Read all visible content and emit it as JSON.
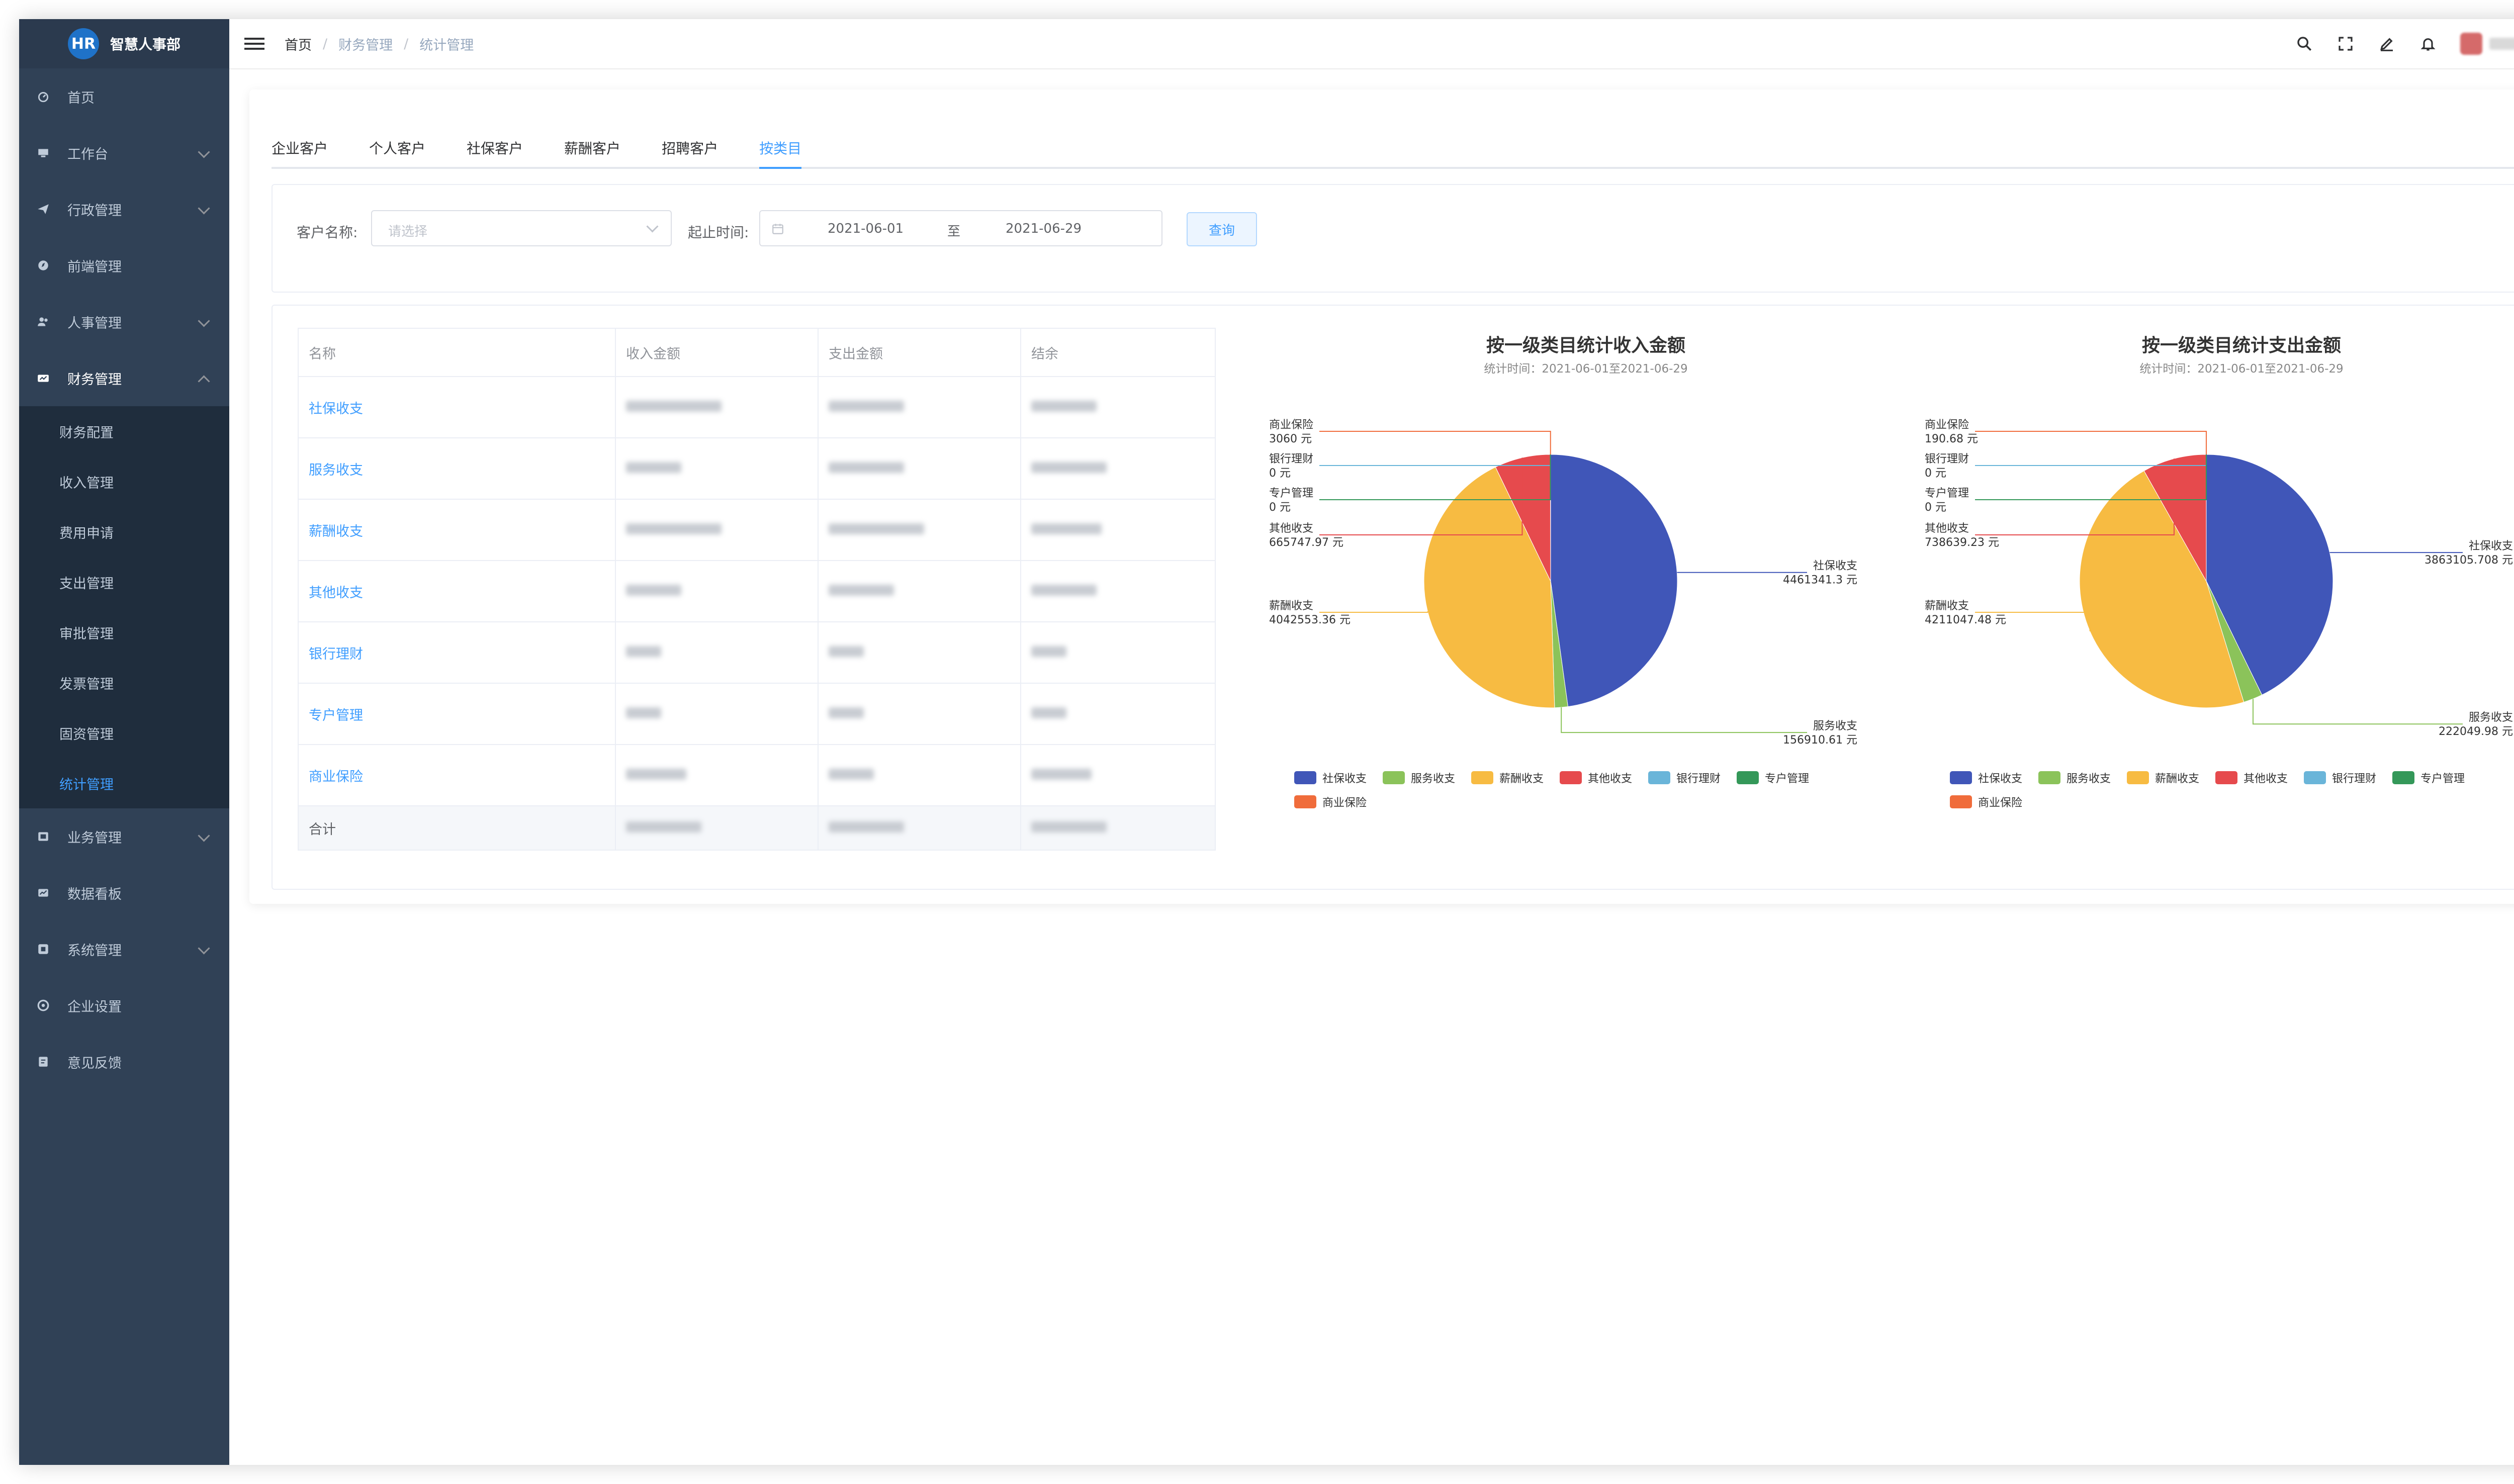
{
  "app": {
    "logo_text": "HR",
    "title": "智慧人事部"
  },
  "sidebar": {
    "items": [
      {
        "label": "首页",
        "icon": "dashboard-icon",
        "has_children": false
      },
      {
        "label": "工作台",
        "icon": "desk-icon",
        "has_children": true
      },
      {
        "label": "行政管理",
        "icon": "send-icon",
        "has_children": true
      },
      {
        "label": "前端管理",
        "icon": "compass-icon",
        "has_children": false
      },
      {
        "label": "人事管理",
        "icon": "people-icon",
        "has_children": true
      },
      {
        "label": "财务管理",
        "icon": "money-icon",
        "has_children": true,
        "open": true,
        "children": [
          "财务配置",
          "收入管理",
          "费用申请",
          "支出管理",
          "审批管理",
          "发票管理",
          "固资管理",
          "统计管理"
        ],
        "active_child": 7
      },
      {
        "label": "业务管理",
        "icon": "briefcase-icon",
        "has_children": true
      },
      {
        "label": "数据看板",
        "icon": "chart-icon",
        "has_children": false
      },
      {
        "label": "系统管理",
        "icon": "system-icon",
        "has_children": true
      },
      {
        "label": "企业设置",
        "icon": "settings-icon",
        "has_children": false
      },
      {
        "label": "意见反馈",
        "icon": "feedback-icon",
        "has_children": false
      }
    ]
  },
  "navbar": {
    "breadcrumb": [
      "首页",
      "财务管理",
      "统计管理"
    ],
    "icons": [
      "search-icon",
      "fullscreen-icon",
      "edit-icon",
      "bell-icon"
    ]
  },
  "tabs": [
    "企业客户",
    "个人客户",
    "社保客户",
    "薪酬客户",
    "招聘客户",
    "按类目"
  ],
  "active_tab": 5,
  "filter": {
    "customer_label": "客户名称:",
    "customer_placeholder": "请选择",
    "date_label": "起止时间:",
    "start_date": "2021-06-01",
    "range_sep": "至",
    "end_date": "2021-06-29",
    "query_button": "查询"
  },
  "table": {
    "headers": [
      "名称",
      "收入金额",
      "支出金额",
      "结余"
    ],
    "rows": [
      {
        "name": "社保收支"
      },
      {
        "name": "服务收支"
      },
      {
        "name": "薪酬收支"
      },
      {
        "name": "其他收支"
      },
      {
        "name": "银行理财"
      },
      {
        "name": "专户管理"
      },
      {
        "name": "商业保险"
      }
    ],
    "total_label": "合计"
  },
  "colors": {
    "sidebar_bg": "#304156",
    "accent": "#409eff",
    "series": [
      "#4056b8",
      "#8bc35a",
      "#f7bb42",
      "#e64a4d",
      "#6ab5d9",
      "#349859",
      "#f06c3b"
    ]
  },
  "chart_data": [
    {
      "type": "pie",
      "title": "按一级类目统计收入金额",
      "subtitle": "统计时间：2021-06-01至2021-06-29",
      "categories": [
        "社保收支",
        "服务收支",
        "薪酬收支",
        "其他收支",
        "银行理财",
        "专户管理",
        "商业保险"
      ],
      "values": [
        4461341.3,
        156910.61,
        4042553.36,
        665747.97,
        0,
        0,
        3060
      ],
      "unit": "元",
      "legend": "bottom"
    },
    {
      "type": "pie",
      "title": "按一级类目统计支出金额",
      "subtitle": "统计时间：2021-06-01至2021-06-29",
      "categories": [
        "社保收支",
        "服务收支",
        "薪酬收支",
        "其他收支",
        "银行理财",
        "专户管理",
        "商业保险"
      ],
      "values": [
        3863105.708,
        222049.98,
        4211047.48,
        738639.23,
        0,
        0,
        190.68
      ],
      "unit": "元",
      "legend": "bottom"
    }
  ]
}
